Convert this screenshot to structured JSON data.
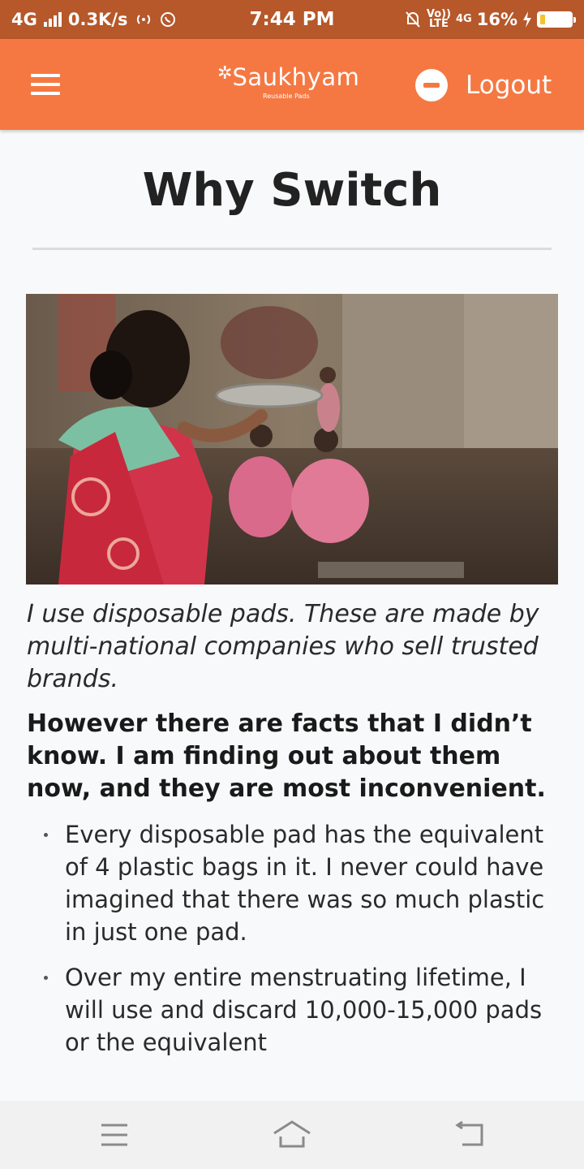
{
  "status_bar": {
    "network": "4G",
    "speed": "0.3K/s",
    "time": "7:44 PM",
    "volte_top": "Vo))",
    "volte_bottom": "LTE",
    "net2": "4G",
    "battery": "16%",
    "battery_level": 0.16
  },
  "header": {
    "brand": "Saukhyam",
    "tagline": "Reusable Pads",
    "logout_label": "Logout"
  },
  "page": {
    "title": "Why Switch",
    "caption": "I use disposable pads. These are made by multi-national companies who sell trusted brands.",
    "lead": "However there are facts that I didn’t know. I am finding out about them now, and they are most inconvenient.",
    "bullets": [
      "Every disposable pad has the equivalent of 4 plastic bags in it. I never could have imagined that there was so much plastic in just one pad.",
      "Over my entire menstruating lifetime, I will use and discard 10,000-15,000 pads or the equivalent"
    ]
  },
  "colors": {
    "status_bar": "#b6582a",
    "header": "#f57842",
    "background": "#f8f9fa"
  },
  "icons": [
    "menu-icon",
    "minus-circle-icon",
    "home-icon",
    "back-icon",
    "recents-icon"
  ]
}
